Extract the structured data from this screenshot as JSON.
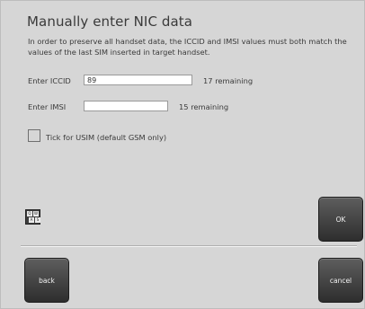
{
  "dialog": {
    "title": "Manually enter NIC data",
    "description": "In order to preserve all handset data, the ICCID and IMSI values must both match the values of the last SIM inserted in target handset."
  },
  "iccid": {
    "label": "Enter ICCID",
    "value": "89",
    "remaining": "17 remaining"
  },
  "imsi": {
    "label": "Enter IMSI",
    "value": "",
    "remaining": "15 remaining"
  },
  "usim": {
    "label": "Tick for USIM  (default GSM only)",
    "checked": false
  },
  "keyboard_icon": {
    "keys": [
      "Q",
      "W",
      "A",
      "S"
    ]
  },
  "buttons": {
    "ok": "OK",
    "back": "back",
    "cancel": "cancel"
  }
}
